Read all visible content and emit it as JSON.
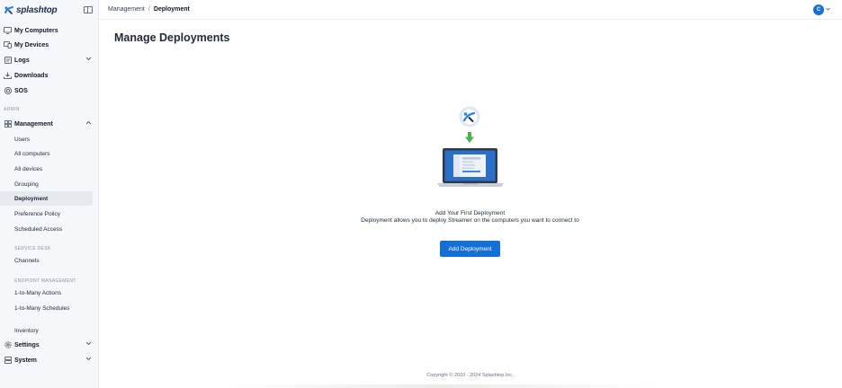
{
  "brand": {
    "name": "splashtop"
  },
  "sidebar": {
    "items": [
      {
        "label": "My Computers",
        "icon": "monitor-icon"
      },
      {
        "label": "My Devices",
        "icon": "devices-icon"
      },
      {
        "label": "Logs",
        "icon": "log-icon"
      },
      {
        "label": "Downloads",
        "icon": "download-icon"
      },
      {
        "label": "SOS",
        "icon": "lifebuoy-icon"
      }
    ],
    "admin_label": "ADMIN",
    "management": {
      "label": "Management",
      "icon": "grid-icon",
      "sub_items": [
        {
          "label": "Users"
        },
        {
          "label": "All computers"
        },
        {
          "label": "All devices"
        },
        {
          "label": "Grouping"
        },
        {
          "label": "Deployment",
          "active": true
        },
        {
          "label": "Preference Policy"
        },
        {
          "label": "Scheduled Access"
        }
      ]
    },
    "service_desk_label": "SERVICE DESK",
    "service_desk_items": [
      {
        "label": "Channels"
      }
    ],
    "endpoint_label": "ENDPOINT MANAGEMENT",
    "endpoint_items": [
      {
        "label": "1-to-Many Actions"
      },
      {
        "label": "1-to-Many Schedules"
      },
      {
        "label": "Inventory"
      }
    ],
    "bottom_items": [
      {
        "label": "Settings",
        "icon": "gear-icon"
      },
      {
        "label": "System",
        "icon": "server-icon"
      }
    ]
  },
  "header": {
    "breadcrumb": [
      "Management",
      "Deployment"
    ],
    "avatar_initial": "C"
  },
  "main": {
    "title": "Manage Deployments",
    "empty_title": "Add Your First Deployment",
    "empty_description": "Deployment allows you to deploy Streamer on the computers you want to connect to",
    "add_button_label": "Add Deployment"
  },
  "footer": {
    "copyright": "Copyright © 2010 - 2024 Splashtop Inc."
  },
  "colors": {
    "accent": "#1570d6",
    "sidebar_bg": "#f5f7fa",
    "arrow": "#4caf50"
  }
}
